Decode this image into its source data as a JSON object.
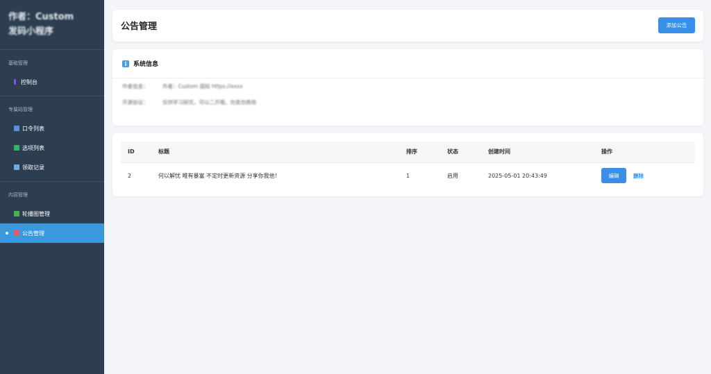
{
  "sidebar": {
    "brand_line1": "作者：Custom",
    "brand_line2": "发码小程序",
    "groups": [
      {
        "title": "基础管理",
        "items": [
          {
            "label": "控制台",
            "icon": "dashboard-icon",
            "color": "#7b5cd6"
          }
        ]
      },
      {
        "title": "专属码管理",
        "items": [
          {
            "label": "口令列表",
            "icon": "list-icon",
            "color": "#5a8fe0"
          },
          {
            "label": "选项列表",
            "icon": "checkbox-icon",
            "color": "#2fb56a"
          },
          {
            "label": "领取记录",
            "icon": "calendar-icon",
            "color": "#6fa8e8"
          }
        ]
      },
      {
        "title": "内容管理",
        "items": [
          {
            "label": "轮播图管理",
            "icon": "image-icon",
            "color": "#4caf50"
          },
          {
            "label": "公告管理",
            "icon": "megaphone-icon",
            "color": "#e05a6a",
            "active": true
          }
        ]
      }
    ]
  },
  "header": {
    "title": "公告管理",
    "add_button": "添加公告"
  },
  "system_info": {
    "title": "系统信息",
    "rows": [
      {
        "key": "作者信息：",
        "value": "作者：Custom 国际 https://xxxx"
      },
      {
        "key": "开源协议：",
        "value": "仅供学习研究，可以二开哦，勿卖勿商用"
      }
    ]
  },
  "table": {
    "headers": [
      "ID",
      "标题",
      "排序",
      "状态",
      "创建时间",
      "操作"
    ],
    "rows": [
      {
        "id": "2",
        "title": "何以解忧 唯有暴富 不定时更新资源 分享你我他！",
        "sort": "1",
        "status": "启用",
        "created_at": "2025-05-01 20:43:49",
        "edit": "编辑",
        "delete": "删除"
      }
    ]
  },
  "colors": {
    "sidebar_bg": "#2c3e50",
    "active_item": "#3a99dd",
    "primary": "#3a8ee6"
  }
}
